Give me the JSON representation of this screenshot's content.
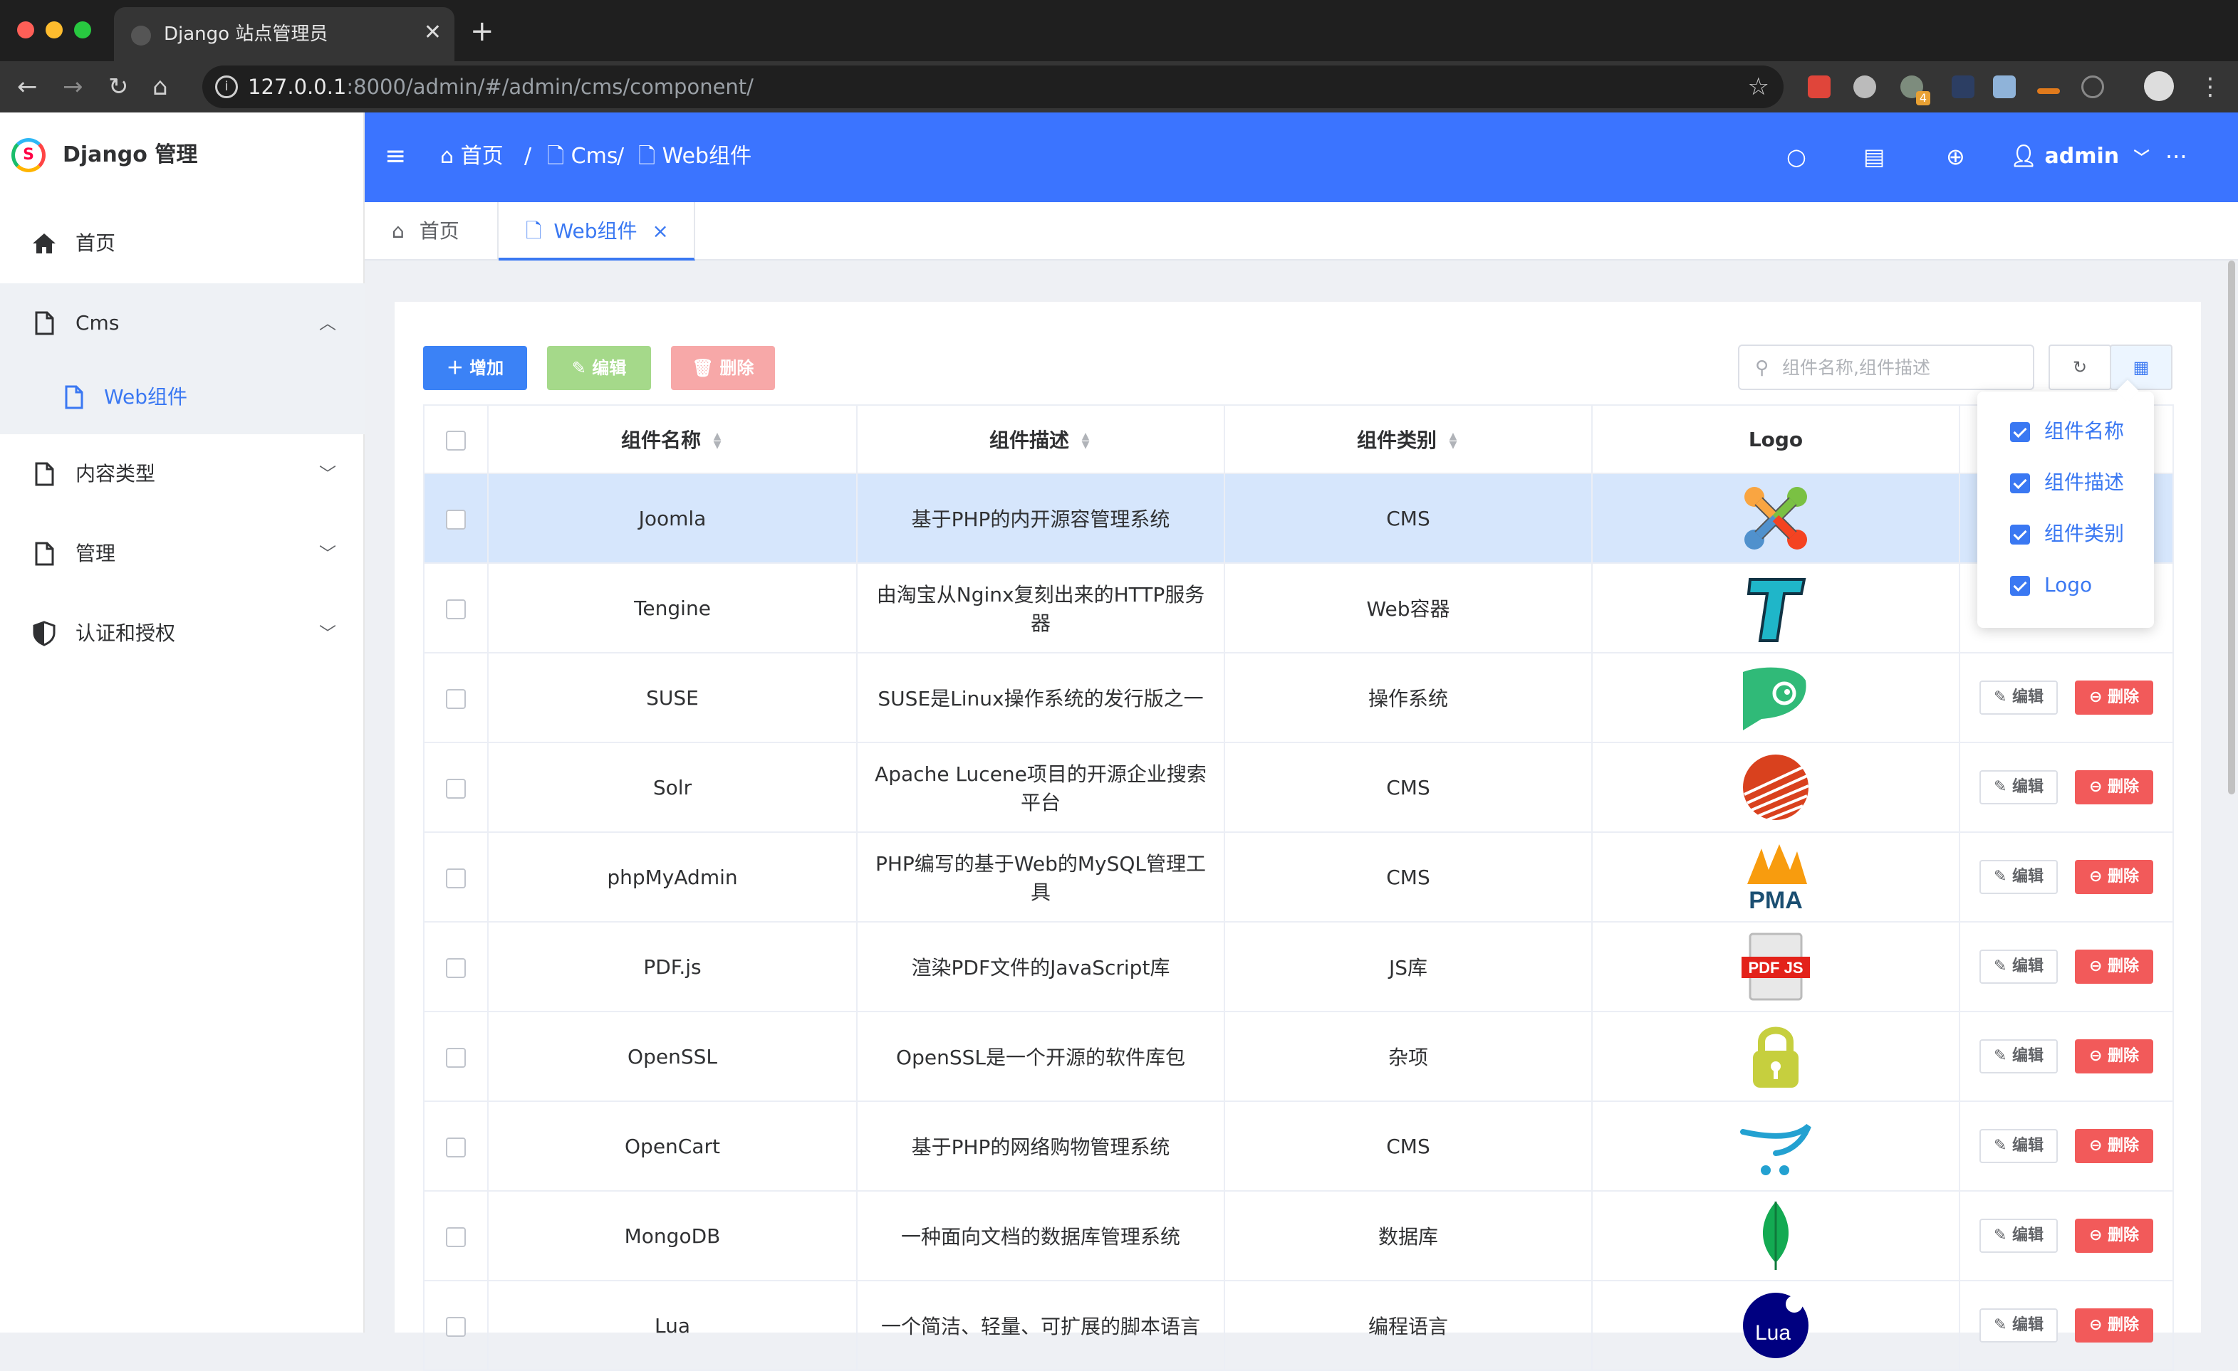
{
  "browser": {
    "tab_title": "Django 站点管理员",
    "url_host": "127.0.0.1",
    "url_rest": ":8000/admin/#/admin/cms/component/",
    "new_tab": "+",
    "close": "✕",
    "ext_badge": "4"
  },
  "sidebar": {
    "brand": "Django 管理",
    "logo_letter": "S",
    "items": [
      {
        "label": "首页"
      },
      {
        "label": "Cms"
      },
      {
        "label": "Web组件"
      },
      {
        "label": "内容类型"
      },
      {
        "label": "管理"
      },
      {
        "label": "认证和授权"
      }
    ]
  },
  "header": {
    "breadcrumbs": [
      "首页",
      "Cms",
      "Web组件"
    ],
    "separator": "/",
    "user": "admin",
    "more": "···"
  },
  "tabs": [
    {
      "label": "首页"
    },
    {
      "label": "Web组件",
      "close": "×"
    }
  ],
  "toolbar": {
    "add": "增加",
    "edit": "编辑",
    "delete": "删除",
    "search_placeholder": "组件名称,组件描述",
    "refresh_icon": "↻",
    "columns_icon": "▦"
  },
  "table": {
    "columns": [
      "组件名称",
      "组件描述",
      "组件类别",
      "Logo"
    ],
    "action_edit": "编辑",
    "action_delete": "删除",
    "rows": [
      {
        "name": "Joomla",
        "desc": "基于PHP的内开源容管理系统",
        "category": "CMS"
      },
      {
        "name": "Tengine",
        "desc": "由淘宝从Nginx复刻出来的HTTP服务器",
        "category": "Web容器"
      },
      {
        "name": "SUSE",
        "desc": "SUSE是Linux操作系统的发行版之一",
        "category": "操作系统"
      },
      {
        "name": "Solr",
        "desc": "Apache Lucene项目的开源企业搜索平台",
        "category": "CMS"
      },
      {
        "name": "phpMyAdmin",
        "desc": "PHP编写的基于Web的MySQL管理工具",
        "category": "CMS"
      },
      {
        "name": "PDF.js",
        "desc": "渲染PDF文件的JavaScript库",
        "category": "JS库"
      },
      {
        "name": "OpenSSL",
        "desc": "OpenSSL是一个开源的软件库包",
        "category": "杂项"
      },
      {
        "name": "OpenCart",
        "desc": "基于PHP的网络购物管理系统",
        "category": "CMS"
      },
      {
        "name": "MongoDB",
        "desc": "一种面向文档的数据库管理系统",
        "category": "数据库"
      },
      {
        "name": "Lua",
        "desc": "一个简洁、轻量、可扩展的脚本语言",
        "category": "编程语言"
      }
    ]
  },
  "column_menu": {
    "options": [
      "组件名称",
      "组件描述",
      "组件类别",
      "Logo"
    ]
  },
  "logo_texts": {
    "pdfjs": "PDF JS",
    "pma": "PMA",
    "lua": "Lua"
  },
  "colors": {
    "header": "#3b74ff",
    "primary": "#3a78f2",
    "add_btn": "#3b82f6",
    "edit_btn": "#a5d98a",
    "delete_btn": "#f7a8a8",
    "danger": "#f25a5a",
    "selected_row": "#d6e6fc"
  }
}
